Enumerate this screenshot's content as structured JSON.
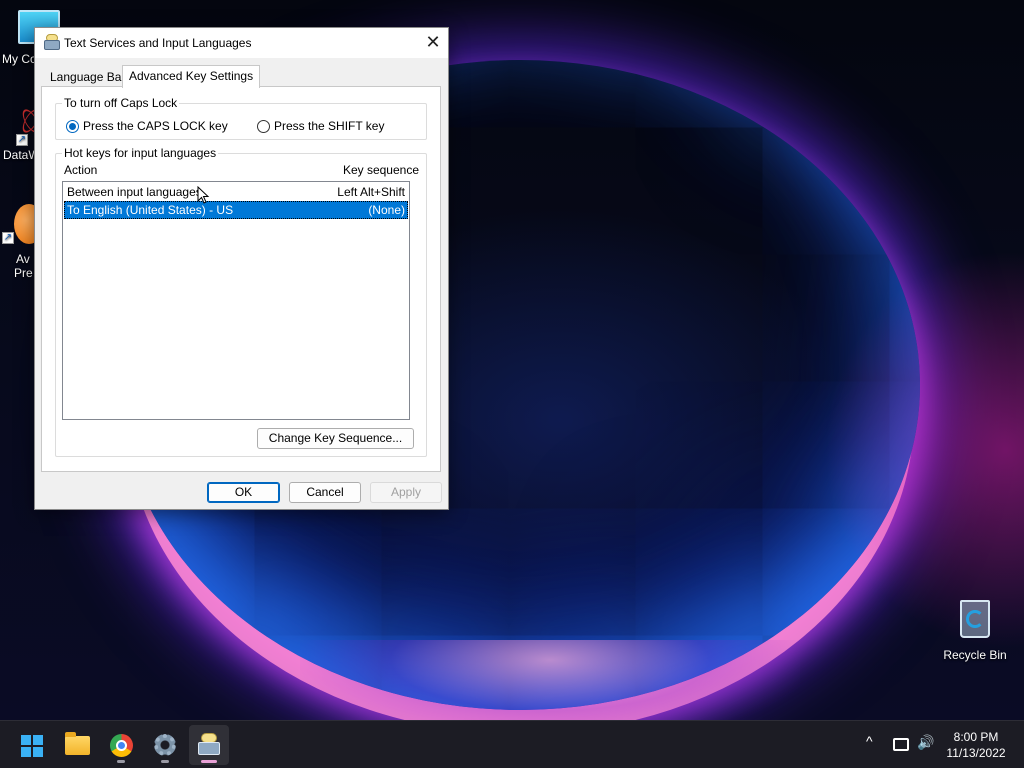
{
  "desktop": {
    "icons": [
      {
        "label": "My Co",
        "icon": "computer-icon"
      },
      {
        "label": "DataW",
        "icon": "dataw-icon"
      },
      {
        "label_line1": "Av",
        "label_line2": "Pre",
        "icon": "avast-icon"
      },
      {
        "label": "Recycle Bin",
        "icon": "recycle-bin-icon"
      }
    ]
  },
  "dialog": {
    "title": "Text Services and Input Languages",
    "close_glyph": "✕",
    "tabs": [
      {
        "label": "Language Bar",
        "active": false
      },
      {
        "label": "Advanced Key Settings",
        "active": true
      }
    ],
    "caps_group": {
      "legend": "To turn off Caps Lock",
      "options": [
        {
          "label": "Press the CAPS LOCK key",
          "checked": true
        },
        {
          "label": "Press the SHIFT key",
          "checked": false
        }
      ]
    },
    "hotkeys_group": {
      "legend": "Hot keys for input languages",
      "columns": {
        "action": "Action",
        "key_sequence": "Key sequence"
      },
      "rows": [
        {
          "action": "Between input languages",
          "key_sequence": "Left Alt+Shift",
          "selected": false
        },
        {
          "action": "To English (United States) - US",
          "key_sequence": "(None)",
          "selected": true
        }
      ],
      "change_button": "Change Key Sequence..."
    },
    "buttons": {
      "ok": "OK",
      "cancel": "Cancel",
      "apply": "Apply"
    }
  },
  "taskbar": {
    "apps": [
      "start-icon",
      "file-explorer-icon",
      "chrome-icon",
      "settings-icon",
      "text-input-icon"
    ],
    "tray": {
      "chevron": "^",
      "volume_glyph": "🔊"
    },
    "clock": {
      "time": "8:00 PM",
      "date": "11/13/2022"
    }
  },
  "colors": {
    "selection": "#0078d7",
    "accent": "#0067c0",
    "taskbar": "#1c1c24"
  }
}
